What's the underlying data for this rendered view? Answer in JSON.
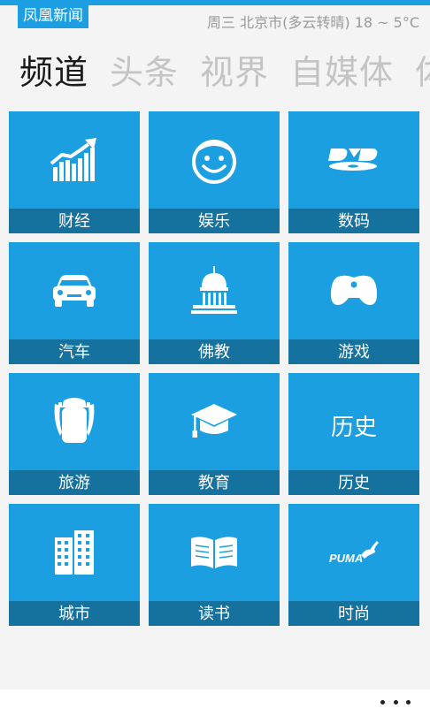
{
  "app": {
    "title": "凤凰新闻"
  },
  "status": {
    "text": "周三 北京市(多云转晴) 18 ~ 5°C"
  },
  "pivot": [
    {
      "label": "频道",
      "active": true
    },
    {
      "label": "头条",
      "active": false
    },
    {
      "label": "视界",
      "active": false
    },
    {
      "label": "自媒体",
      "active": false
    },
    {
      "label": "体",
      "active": false
    }
  ],
  "tiles": [
    {
      "label": "财经",
      "icon": "growth-chart-icon"
    },
    {
      "label": "娱乐",
      "icon": "smiley-halo-icon"
    },
    {
      "label": "数码",
      "icon": "dvd-icon"
    },
    {
      "label": "汽车",
      "icon": "car-icon"
    },
    {
      "label": "佛教",
      "icon": "capitol-building-icon"
    },
    {
      "label": "游戏",
      "icon": "gamepad-icon"
    },
    {
      "label": "旅游",
      "icon": "backpack-icon"
    },
    {
      "label": "教育",
      "icon": "graduation-cap-icon"
    },
    {
      "label": "历史",
      "icon_text": "历史"
    },
    {
      "label": "城市",
      "icon": "buildings-icon"
    },
    {
      "label": "读书",
      "icon": "open-book-icon"
    },
    {
      "label": "时尚",
      "icon": "puma-logo-icon",
      "logo_text": "PUMA"
    }
  ],
  "colors": {
    "accent": "#1b9ee2",
    "tile": "#1c9fe1",
    "tile_label": "#15719e",
    "pivot_active": "#1a1a1a",
    "pivot_inactive": "#c4c4c4",
    "status": "#9a9a9a"
  },
  "app_bar": {
    "more_icon": "more-dots-icon"
  }
}
